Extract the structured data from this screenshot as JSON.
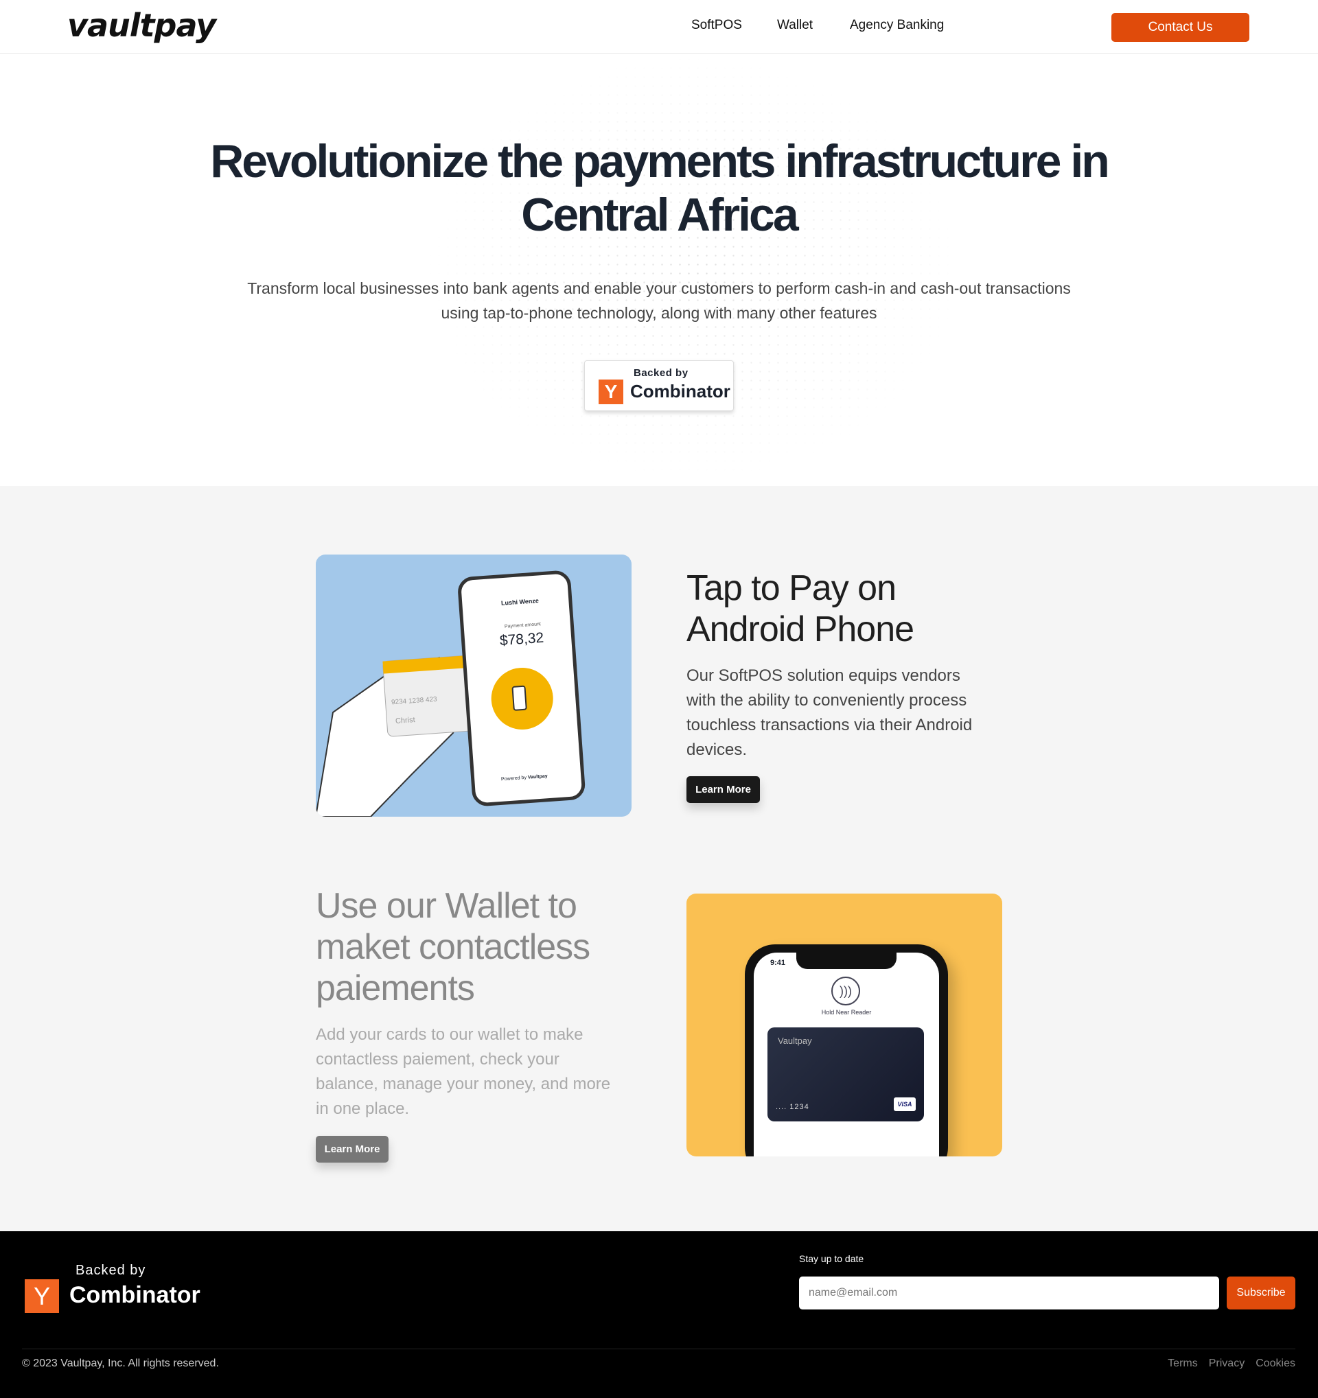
{
  "nav": {
    "logo": "vaultpay",
    "links": [
      "SoftPOS",
      "Wallet",
      "Agency Banking"
    ],
    "contact": "Contact Us"
  },
  "hero": {
    "title_line1": "Revolutionize the payments infrastructure in",
    "title_line2": "Central Africa",
    "subtitle_line1": "Transform local businesses into bank agents and enable your customers to perform cash-in and cash-out transactions",
    "subtitle_line2": "using tap-to-phone technology, along with many other features",
    "badge": {
      "backed": "Backed by",
      "y": "Y",
      "name": "Combinator"
    }
  },
  "features": [
    {
      "title_line1": "Tap to Pay on",
      "title_line2": "Android Phone",
      "body": "Our SoftPOS solution equips vendors with the ability to conveniently process touchless transactions via their Android devices.",
      "button": "Learn More",
      "image": {
        "merchant": "Lushi Wenze",
        "amount_label": "Payment amount",
        "amount": "$78,32",
        "card_number": "9234  1238  423",
        "card_name": "Christ",
        "powered": "Powered by",
        "brand": "Vaultpay",
        "bg": "#a3c8ea"
      }
    },
    {
      "title_line1": "Use our Wallet to",
      "title_line2": "maket contactless",
      "title_line3": "paiements",
      "body": "Add your cards to our wallet to make contactless paiement, check your balance, manage your money, and more in one place.",
      "button": "Learn More",
      "image": {
        "time": "9:41",
        "hold": "Hold Near Reader",
        "card_brand": "Vaultpay",
        "card_number": ".... 1234",
        "network": "VISA",
        "bg": "#fac052"
      }
    }
  ],
  "footer": {
    "backed": "Backed by",
    "y": "Y",
    "name": "Combinator",
    "stay": "Stay up to date",
    "email_placeholder": "name@email.com",
    "subscribe": "Subscribe",
    "copyright": "© 2023 Vaultpay, Inc. All rights reserved.",
    "links": [
      "Terms",
      "Privacy",
      "Cookies"
    ]
  },
  "colors": {
    "accent": "#e04b0b",
    "yc": "#f26522"
  }
}
